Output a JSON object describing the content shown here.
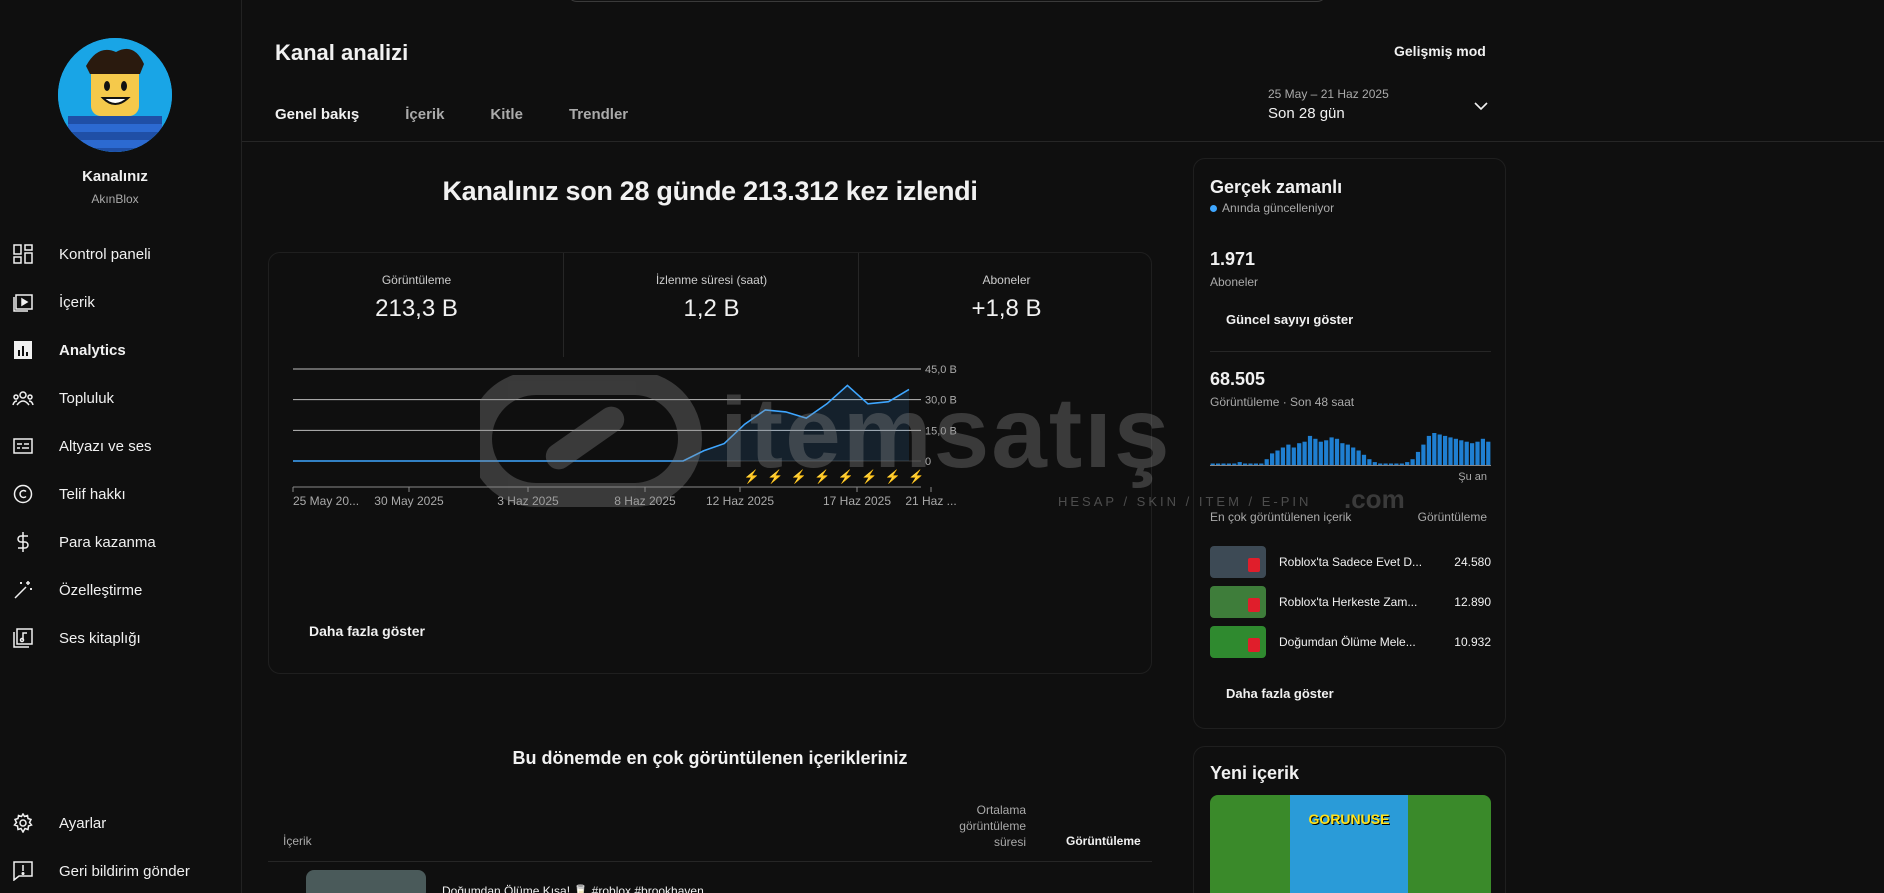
{
  "sidebar": {
    "channel_name": "Kanalınız",
    "channel_handle": "AkınBlox",
    "items": [
      {
        "label": "Kontrol paneli",
        "icon": "dashboard-icon"
      },
      {
        "label": "İçerik",
        "icon": "content-icon"
      },
      {
        "label": "Analytics",
        "icon": "analytics-icon",
        "active": true
      },
      {
        "label": "Topluluk",
        "icon": "community-icon"
      },
      {
        "label": "Altyazı ve ses",
        "icon": "subtitles-icon"
      },
      {
        "label": "Telif hakkı",
        "icon": "copyright-icon"
      },
      {
        "label": "Para kazanma",
        "icon": "dollar-icon"
      },
      {
        "label": "Özelleştirme",
        "icon": "magic-wand-icon"
      },
      {
        "label": "Ses kitaplığı",
        "icon": "audio-library-icon"
      }
    ],
    "bottom": [
      {
        "label": "Ayarlar",
        "icon": "gear-icon"
      },
      {
        "label": "Geri bildirim gönder",
        "icon": "feedback-icon"
      }
    ]
  },
  "header": {
    "title": "Kanal analizi",
    "advanced_mode": "Gelişmiş mod",
    "tabs": [
      "Genel bakış",
      "İçerik",
      "Kitle",
      "Trendler"
    ],
    "date_range": "25 May – 21 Haz 2025",
    "date_label": "Son 28 gün"
  },
  "main": {
    "headline": "Kanalınız son 28 günde 213.312 kez izlendi",
    "metrics": [
      {
        "label": "Görüntüleme",
        "value": "213,3 B"
      },
      {
        "label": "İzlenme süresi (saat)",
        "value": "1,2 B"
      },
      {
        "label": "Aboneler",
        "value": "+1,8 B"
      }
    ],
    "more": "Daha fazla göster"
  },
  "chart_data": {
    "type": "area",
    "x_ticks": [
      "25 May 20...",
      "30 May 2025",
      "3 Haz 2025",
      "8 Haz 2025",
      "12 Haz 2025",
      "17 Haz 2025",
      "21 Haz ..."
    ],
    "y_ticks": [
      "45,0 B",
      "30,0 B",
      "15,0 B",
      "0"
    ],
    "ylim": [
      0,
      45000
    ],
    "x_days": 28,
    "series": [
      {
        "values": [
          0,
          0,
          0,
          0,
          0,
          0,
          0,
          0,
          0,
          0,
          0,
          0,
          0,
          0,
          0,
          0,
          0,
          0,
          0,
          0,
          5000,
          8500,
          18000,
          25000,
          24000,
          21000,
          28000,
          37000,
          28000,
          29000,
          35000
        ]
      }
    ],
    "color": "#3ea6ff"
  },
  "top_content": {
    "title": "Bu dönemde en çok görüntülenen içerikleriniz",
    "col_content": "İçerik",
    "col_avg": [
      "Ortalama",
      "görüntüleme",
      "süresi"
    ],
    "col_views": "Görüntüleme",
    "row_title": "Doğumdan Ölüme Kısa! 🥛 #roblox #brookhaven"
  },
  "realtime": {
    "title": "Gerçek zamanlı",
    "live": "Anında güncelleniyor",
    "subs_value": "1.971",
    "subs_label": "Aboneler",
    "show_count": "Güncel sayıyı göster",
    "views_value": "68.505",
    "views_label": "Görüntüleme · Son 48 saat",
    "now": "Şu an",
    "list_head": "En çok görüntülenen içerik",
    "list_head2": "Görüntüleme",
    "items": [
      {
        "title": "Roblox'ta Sadece Evet D...",
        "count": "24.580"
      },
      {
        "title": "Roblox'ta Herkeste Zam...",
        "count": "12.890"
      },
      {
        "title": "Doğumdan Ölüme Mele...",
        "count": "10.932"
      }
    ],
    "more": "Daha fazla göster",
    "bars": [
      1,
      1,
      1,
      1,
      1,
      2,
      1,
      1,
      1,
      1,
      4,
      8,
      10,
      12,
      14,
      12,
      15,
      16,
      20,
      18,
      16,
      17,
      19,
      18,
      15,
      14,
      12,
      10,
      7,
      4,
      2,
      1,
      1,
      1,
      1,
      1,
      2,
      4,
      9,
      14,
      20,
      22,
      21,
      20,
      19,
      18,
      17,
      16,
      15,
      16,
      18,
      16
    ]
  },
  "new_content": {
    "title": "Yeni içerik",
    "thumb_text": "GORUNUSE"
  },
  "watermark": {
    "brand": "itemsatış",
    "tagline": "HESAP / SKIN / ITEM / E-PIN",
    "suffix": ".com"
  }
}
